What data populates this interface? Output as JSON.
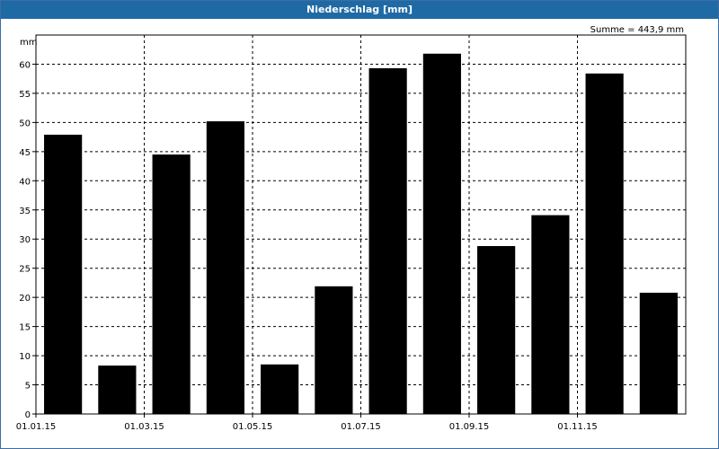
{
  "window": {
    "title": "Niederschlag [mm]"
  },
  "chart_data": {
    "type": "bar",
    "title": "Niederschlag [mm]",
    "ylabel": "mm",
    "annotation": "Summe = 443,9 mm",
    "ylim": [
      0,
      65
    ],
    "yticks": [
      0,
      5,
      10,
      15,
      20,
      25,
      30,
      35,
      40,
      45,
      50,
      55,
      60
    ],
    "x_tick_labels": [
      "01.01.15",
      "01.03.15",
      "01.05.15",
      "01.07.15",
      "01.09.15",
      "01.11.15"
    ],
    "categories": [
      "Jan 15",
      "Feb 15",
      "Mar 15",
      "Apr 15",
      "May 15",
      "Jun 15",
      "Jul 15",
      "Aug 15",
      "Sep 15",
      "Oct 15",
      "Nov 15",
      "Dec 15"
    ],
    "values": [
      47.9,
      8.3,
      44.5,
      50.2,
      8.5,
      21.9,
      59.3,
      61.8,
      28.8,
      34.1,
      58.4,
      20.8
    ],
    "bar_color": "#000000",
    "grid": true
  }
}
